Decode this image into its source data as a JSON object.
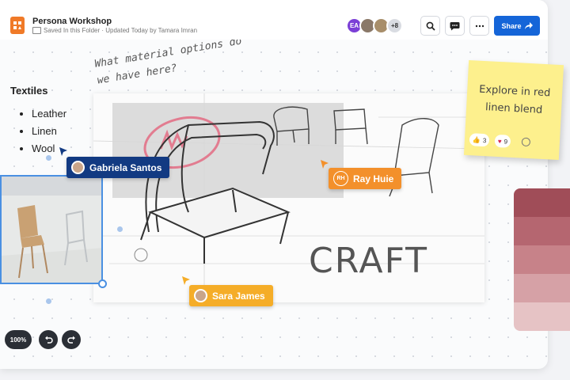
{
  "header": {
    "title": "Persona Workshop",
    "subtitle": "Saved In this Folder · Updated Today by Tamara Imran",
    "avatar_initials": "EA",
    "more_count": "+8",
    "share_label": "Share",
    "icons": [
      "search-icon",
      "comment-icon",
      "more-icon",
      "share-arrow-icon"
    ]
  },
  "list": {
    "title": "Textiles",
    "items": [
      "Leather",
      "Linen",
      "Wool"
    ]
  },
  "question": "What material options do we have here?",
  "sketch": {
    "craft_label": "CRAFT"
  },
  "collaborators": {
    "gabriela": "Gabriela Santos",
    "ray": "Ray Huie",
    "ray_initials": "RH",
    "sara": "Sara James"
  },
  "sticky": {
    "text": "Explore in red linen blend",
    "thumbs_count": "3",
    "heart_count": "9"
  },
  "toolbar": {
    "zoom": "100%"
  },
  "colors": {
    "accent": "#1565d8",
    "gabriela_tag": "#123a82",
    "ray_tag": "#f3902b",
    "sara_tag": "#f5ad28",
    "sticky": "#fdf08d"
  }
}
